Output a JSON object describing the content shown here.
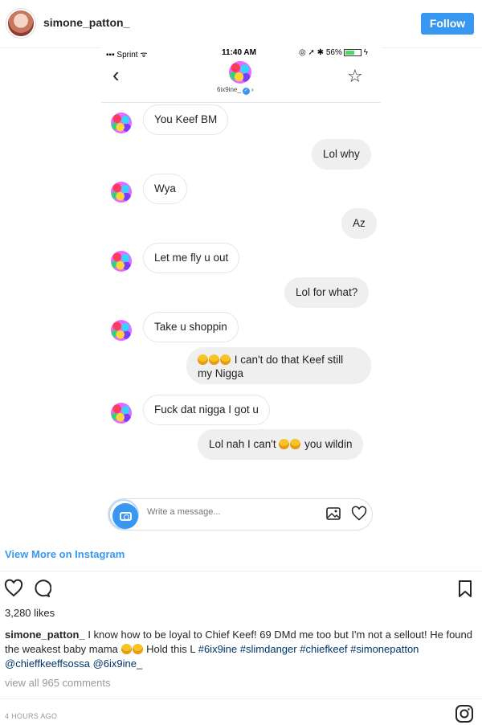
{
  "header": {
    "username": "simone_patton_",
    "follow_label": "Follow"
  },
  "phone": {
    "status": {
      "carrier": "Sprint",
      "time": "11:40 AM",
      "battery": "56%"
    },
    "chat_name": "6ix9ine_",
    "messages": [
      {
        "from": "them",
        "text": "You Keef BM"
      },
      {
        "from": "me",
        "text": "Lol why"
      },
      {
        "from": "them",
        "text": "Wya"
      },
      {
        "from": "me",
        "text": "Az"
      },
      {
        "from": "them",
        "text": "Let me fly u out"
      },
      {
        "from": "me",
        "text": "Lol for what?"
      },
      {
        "from": "them",
        "text": "Take u shoppin"
      },
      {
        "from": "me",
        "text": "I can't do that Keef still",
        "text2": "my Nigga"
      },
      {
        "from": "them",
        "text": "Fuck dat nigga I got u"
      },
      {
        "from": "me",
        "text": "Lol nah I can't",
        "text2": "you wildin"
      }
    ],
    "composer_placeholder": "Write a message..."
  },
  "view_more": "View More on Instagram",
  "likes": "3,280 likes",
  "caption": {
    "user": "simone_patton_",
    "text": "I know how to be loyal to Chief Keef! 69 DMd me too but I'm not a sellout! He found the weakest baby mama",
    "text2": "Hold this L",
    "tags": [
      "#6ix9ine",
      "#slimdanger",
      "#chiefkeef",
      "#simonepatton",
      "@chieffkeeffsossa",
      "@6ix9ine_"
    ]
  },
  "comments_link": "view all 965 comments",
  "timestamp": "4 HOURS AGO",
  "colors": {
    "accent": "#3897f0",
    "tag": "#003569"
  }
}
